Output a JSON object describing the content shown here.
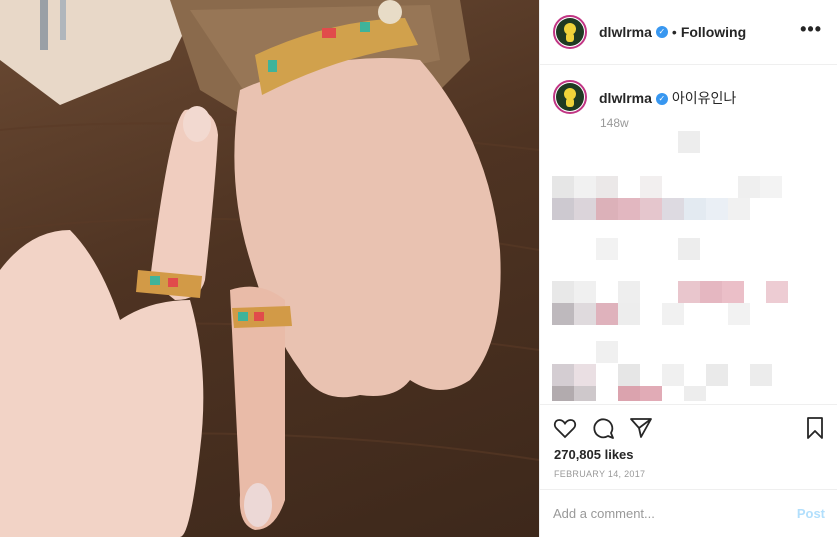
{
  "header": {
    "username": "dlwlrma",
    "verified_glyph": "✓",
    "separator": "•",
    "follow_status": "Following",
    "more_icon": "•••"
  },
  "caption": {
    "username": "dlwlrma",
    "text": "아이유인나",
    "age": "148w"
  },
  "actions": {
    "likes": "270,805 likes",
    "date": "FEBRUARY 14, 2017"
  },
  "comment": {
    "placeholder": "Add a comment...",
    "post_label": "Post"
  },
  "colors": {
    "verified": "#3897f0",
    "story_ring": "#c13584",
    "post_disabled": "#b2dffc"
  }
}
